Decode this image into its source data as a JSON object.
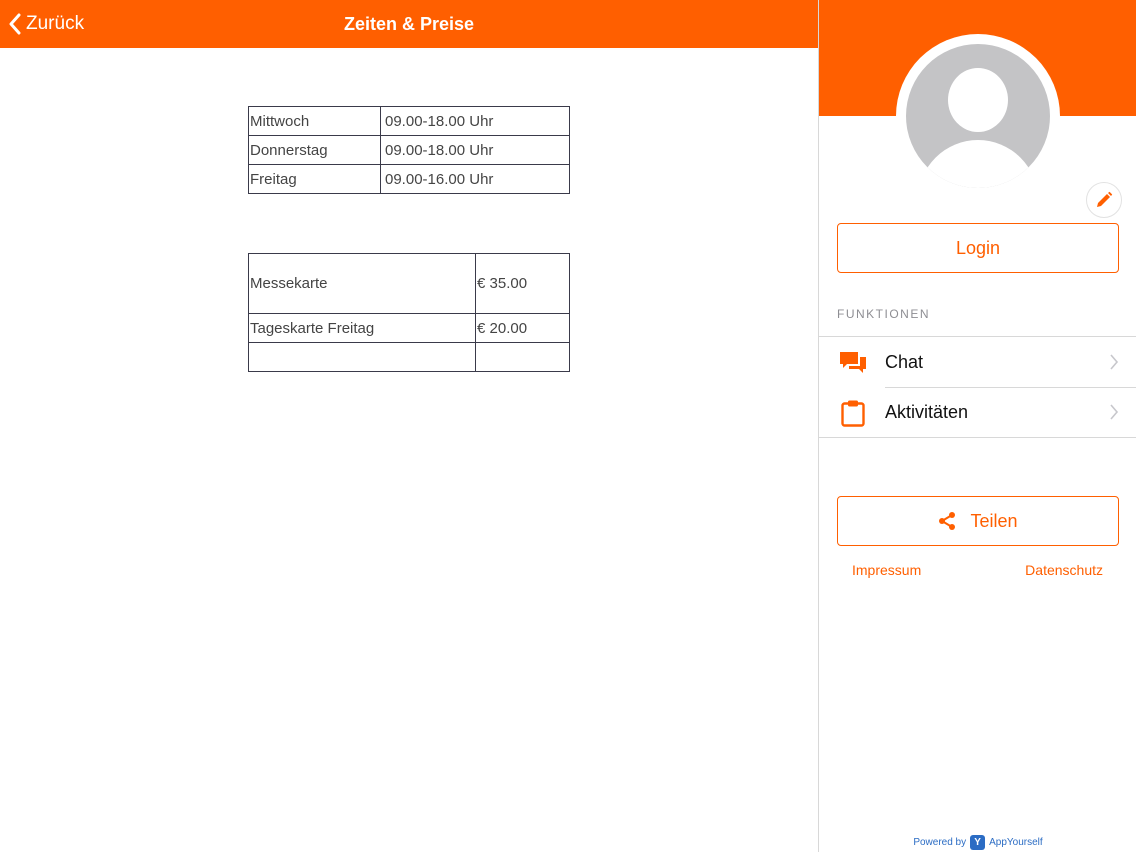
{
  "colors": {
    "accent": "#ff5f00",
    "text": "#333333",
    "muted": "#8e8e93",
    "link_blue": "#2b6cc4"
  },
  "topbar": {
    "back_label": "Zurück",
    "title": "Zeiten & Preise"
  },
  "hours_table": {
    "rows": [
      [
        "Mittwoch",
        "09.00-18.00 Uhr"
      ],
      [
        "Donnerstag",
        "09.00-18.00 Uhr"
      ],
      [
        "Freitag",
        "09.00-16.00 Uhr"
      ]
    ]
  },
  "prices_table": {
    "rows": [
      [
        "Messekarte",
        "€ 35.00"
      ],
      [
        "Tageskarte Freitag",
        "€ 20.00"
      ],
      [
        "",
        ""
      ]
    ]
  },
  "sidebar": {
    "avatar_icon": "user-placeholder-icon",
    "edit_icon": "pencil-icon",
    "login_label": "Login",
    "section_label": "FUNKTIONEN",
    "menu": [
      {
        "label": "Chat",
        "icon": "chat-bubbles-icon"
      },
      {
        "label": "Aktivitäten",
        "icon": "clipboard-icon"
      }
    ],
    "share_label": "Teilen",
    "share_icon": "share-icon",
    "impressum_label": "Impressum",
    "datenschutz_label": "Datenschutz",
    "powered_by_label": "Powered by",
    "brand_logo_letter": "Y",
    "brand_name": "AppYourself"
  }
}
